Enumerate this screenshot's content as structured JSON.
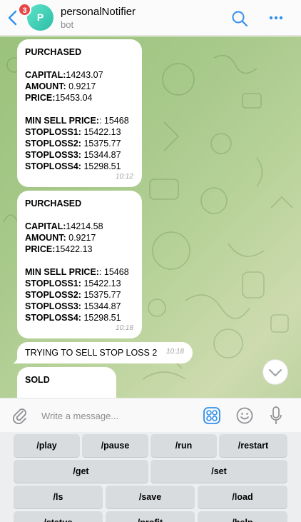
{
  "header": {
    "unread_count": "3",
    "avatar_letter": "P",
    "title": "personalNotifier",
    "subtitle": "bot"
  },
  "messages": [
    {
      "lines": [
        {
          "b": "PURCHASED",
          "t": ""
        },
        {
          "b": "",
          "t": ""
        },
        {
          "b": "CAPITAL:",
          "t": "14243.07"
        },
        {
          "b": "AMOUNT:",
          "t": " 0.9217"
        },
        {
          "b": "PRICE:",
          "t": "15453.04"
        },
        {
          "b": "",
          "t": ""
        },
        {
          "b": "MIN SELL PRICE:",
          "t": ": 15468"
        },
        {
          "b": "STOPLOSS1:",
          "t": " 15422.13"
        },
        {
          "b": "STOPLOSS2:",
          "t": " 15375.77"
        },
        {
          "b": "STOPLOSS3:",
          "t": " 15344.87"
        },
        {
          "b": "STOPLOSS4:",
          "t": " 15298.51"
        }
      ],
      "time": "10:12"
    },
    {
      "lines": [
        {
          "b": "PURCHASED",
          "t": ""
        },
        {
          "b": "",
          "t": ""
        },
        {
          "b": "CAPITAL:",
          "t": "14214.58"
        },
        {
          "b": "AMOUNT:",
          "t": " 0.9217"
        },
        {
          "b": "PRICE:",
          "t": "15422.13"
        },
        {
          "b": "",
          "t": ""
        },
        {
          "b": "MIN SELL PRICE:",
          "t": ": 15468"
        },
        {
          "b": "STOPLOSS1:",
          "t": " 15422.13"
        },
        {
          "b": "STOPLOSS2:",
          "t": " 15375.77"
        },
        {
          "b": "STOPLOSS3:",
          "t": " 15344.87"
        },
        {
          "b": "STOPLOSS4:",
          "t": " 15298.51"
        }
      ],
      "time": "10:18"
    },
    {
      "text": "TRYING TO SELL STOP LOSS 2",
      "time": "10:18"
    },
    {
      "text": "SOLD"
    }
  ],
  "composer": {
    "placeholder": "Write a message..."
  },
  "keyboard": {
    "row1": [
      "/play",
      "/pause",
      "/run",
      "/restart"
    ],
    "row2": [
      "/get",
      "/set"
    ],
    "row3": [
      "/ls",
      "/save",
      "/load"
    ],
    "row4": [
      "/status",
      "/profit",
      "/help"
    ]
  },
  "colors": {
    "accent": "#3390ec",
    "badge": "#e64646",
    "avatar": "#3ccfb4"
  }
}
